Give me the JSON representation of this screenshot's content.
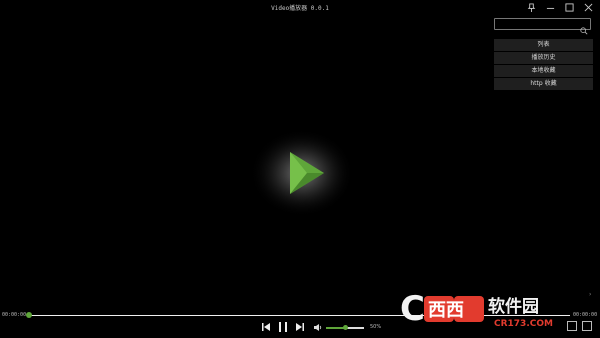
{
  "window": {
    "title": "Video播放器 0.0.1"
  },
  "search": {
    "value": "",
    "placeholder": ""
  },
  "menu": {
    "items": [
      {
        "label": "列表"
      },
      {
        "label": "播放历史"
      },
      {
        "label": "本地收藏"
      },
      {
        "label": "http 收藏"
      }
    ]
  },
  "timeline": {
    "current": "00:00:00",
    "total": "00:00:00",
    "progress": 0
  },
  "volume": {
    "percent_label": "50%",
    "level": 0.5
  },
  "watermark": {
    "brand": "西西软件园",
    "site": "CR173.COM"
  },
  "colors": {
    "accent": "#5fa63a",
    "background": "#000000",
    "menu_bg": "#1f1f1f"
  },
  "icons": {
    "pin": "pin-icon",
    "minimize": "minimize-icon",
    "maximize": "maximize-icon",
    "close": "close-icon",
    "search": "search-icon",
    "play_big": "play-triangle-icon",
    "prev": "previous-icon",
    "pause": "pause-icon",
    "next": "next-icon",
    "volume": "speaker-icon"
  }
}
